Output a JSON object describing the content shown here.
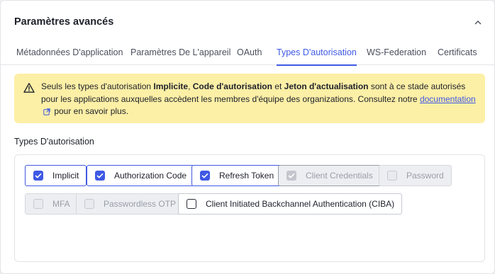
{
  "section": {
    "title": "Paramètres avancés",
    "collapse_icon": "chevron-up-icon"
  },
  "tabs": [
    {
      "label": "Métadonnées D'application",
      "active": false
    },
    {
      "label": "Paramètres De L'appareil",
      "active": false
    },
    {
      "label": "OAuth",
      "active": false
    },
    {
      "label": "Types D'autorisation",
      "active": true
    },
    {
      "label": "WS-Federation",
      "active": false
    },
    {
      "label": "Certificats",
      "active": false
    }
  ],
  "alert": {
    "icon": "warning-icon",
    "text_1": "Seuls les types d'autorisation ",
    "bold_1": "Implicite",
    "text_2": ", ",
    "bold_2": "Code d'autorisation",
    "text_3": " et ",
    "bold_3": "Jeton d'actualisation",
    "text_4": " sont à ce stade autorisés pour les applications auxquelles accèdent les membres d'équipe des organizations. Consultez notre ",
    "link": "documentation",
    "link_icon": "external-link-icon",
    "text_5": " pour en savoir plus.",
    "background": "#fcefa6"
  },
  "grant_types": {
    "label": "Types D'autorisation",
    "options": [
      {
        "label": "Implicit",
        "checked": true,
        "disabled": false
      },
      {
        "label": "Authorization Code",
        "checked": true,
        "disabled": false
      },
      {
        "label": "Refresh Token",
        "checked": true,
        "disabled": false
      },
      {
        "label": "Client Credentials",
        "checked": true,
        "disabled": true
      },
      {
        "label": "Password",
        "checked": false,
        "disabled": true
      },
      {
        "label": "MFA",
        "checked": false,
        "disabled": true
      },
      {
        "label": "Passwordless OTP",
        "checked": false,
        "disabled": true
      },
      {
        "label": "Client Initiated Backchannel Authentication (CIBA)",
        "checked": false,
        "disabled": false
      }
    ]
  },
  "colors": {
    "accent": "#3f59e4",
    "text": "#1e212a",
    "muted": "#4b4f5c",
    "disabled_bg": "#eceef1"
  }
}
